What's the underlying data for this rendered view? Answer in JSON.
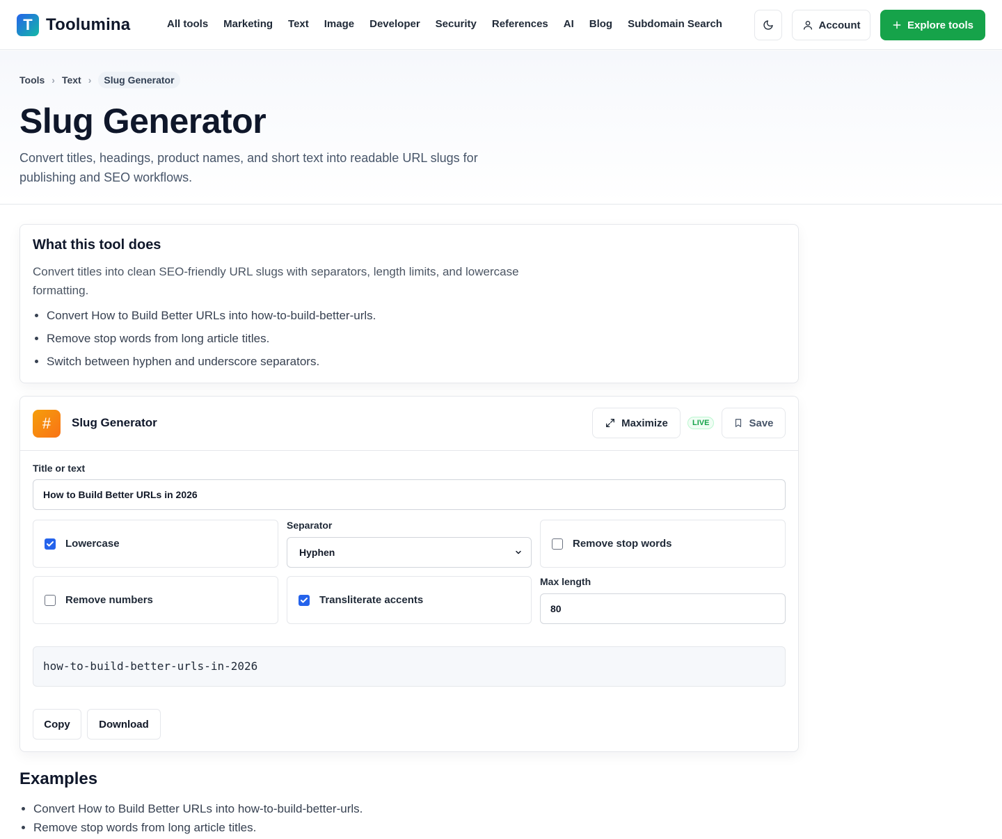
{
  "brand": {
    "logo_letter": "T",
    "name": "Toolumina"
  },
  "nav": [
    "All tools",
    "Marketing",
    "Text",
    "Image",
    "Developer",
    "Security",
    "References",
    "AI",
    "Blog",
    "Subdomain Search"
  ],
  "header": {
    "theme_icon": "moon-icon",
    "account_label": "Account",
    "explore_label": "Explore tools"
  },
  "breadcrumb": [
    "Tools",
    "Text",
    "Slug Generator"
  ],
  "page": {
    "title": "Slug Generator",
    "description": "Convert titles, headings, product names, and short text into readable URL slugs for publishing and SEO workflows."
  },
  "about": {
    "title": "What this tool does",
    "description": "Convert titles into clean SEO-friendly URL slugs with separators, length limits, and lowercase formatting.",
    "bullets": [
      "Convert How to Build Better URLs into how-to-build-better-urls.",
      "Remove stop words from long article titles.",
      "Switch between hyphen and underscore separators."
    ]
  },
  "tool": {
    "icon_glyph": "#",
    "name": "Slug Generator",
    "maximize_label": "Maximize",
    "live_badge": "LIVE",
    "save_label": "Save",
    "input_label": "Title or text",
    "input_value": "How to Build Better URLs in 2026",
    "options": {
      "lowercase": {
        "label": "Lowercase",
        "checked": true
      },
      "separator": {
        "label": "Separator",
        "value": "Hyphen"
      },
      "remove_stop_words": {
        "label": "Remove stop words",
        "checked": false
      },
      "remove_numbers": {
        "label": "Remove numbers",
        "checked": false
      },
      "transliterate": {
        "label": "Transliterate accents",
        "checked": true
      },
      "max_length": {
        "label": "Max length",
        "value": "80"
      }
    },
    "output": "how-to-build-better-urls-in-2026",
    "copy_label": "Copy",
    "download_label": "Download"
  },
  "examples": {
    "title": "Examples",
    "items": [
      "Convert How to Build Better URLs into how-to-build-better-urls.",
      "Remove stop words from long article titles."
    ]
  },
  "colors": {
    "accent": "#16a34a",
    "checkbox": "#2563eb",
    "tool_icon": "#f59e0b"
  }
}
